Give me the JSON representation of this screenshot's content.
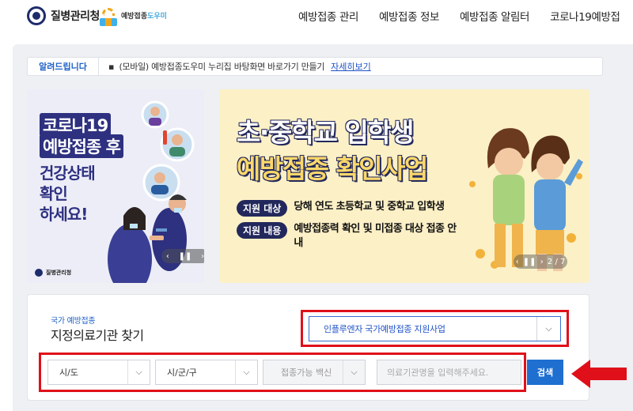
{
  "header": {
    "org_name": "질병관리청",
    "helper_logo_prefix": "예방접종",
    "helper_logo_accent": "도우미",
    "nav": [
      "예방접종 관리",
      "예방접종 정보",
      "예방접종 알림터",
      "코로나19예방접"
    ]
  },
  "notice": {
    "label": "알려드립니다",
    "bullet": "▪",
    "text": "(모바일) 예방접종도우미 누리집 바탕화면 바로가기 만들기",
    "link": "자세히보기"
  },
  "banner_left": {
    "line1": "코로나19",
    "line2": "예방접종 후",
    "line3": "건강상태",
    "line4": "확인",
    "line5": "하세요!",
    "logo_text": "질병관리청",
    "pager": {
      "prev": "‹",
      "pause": "❚❚",
      "next": "›"
    }
  },
  "banner_right": {
    "title1": "초·중학교 입학생",
    "title2": "예방접종 확인사업",
    "rows": [
      {
        "pill": "지원 대상",
        "desc": "당해 연도 초등학교 및 중학교 입학생"
      },
      {
        "pill": "지원 내용",
        "desc": "예방접종력 확인 및 미접종 대상 접종 안내"
      }
    ],
    "pager": {
      "prev": "‹",
      "pause": "❚❚",
      "next": "›",
      "count": "2 / 7"
    }
  },
  "search": {
    "subtitle": "국가 예방접종",
    "title": "지정의료기관 찾기",
    "program_selected": "인플루엔자 국가예방접종 지원사업",
    "sido": "시/도",
    "sigungu": "시/군/구",
    "vaccine": "접종가능 백신",
    "institution_placeholder": "의료기관명을 입력해주세요.",
    "button": "검색",
    "chevron": "⌵"
  },
  "colors": {
    "brand_blue": "#1f6fd1",
    "highlight_red": "#e0101a",
    "navy": "#23285c",
    "banner_yellow": "#fcf0c6"
  }
}
